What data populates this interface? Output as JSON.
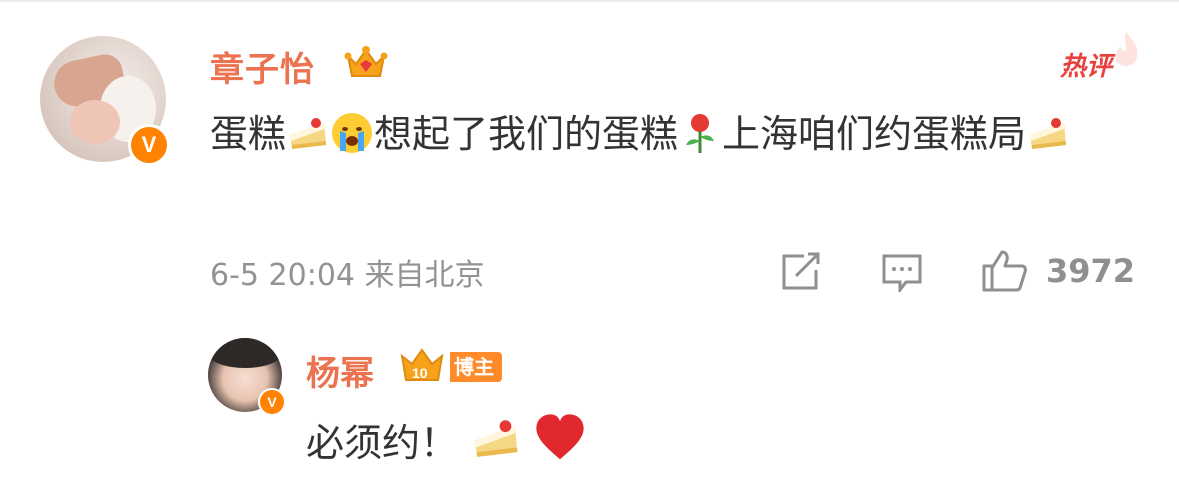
{
  "main_comment": {
    "author": "章子怡",
    "hot_label": "热评",
    "content_segments": [
      "蛋糕",
      "想起了我们的蛋糕",
      "上海咱们约蛋糕局"
    ],
    "timestamp": "6-5 20:04",
    "location": "来自北京",
    "like_count": "3972",
    "emojis": [
      "cake-emoji",
      "crying-emoji",
      "rose-emoji",
      "cake-emoji"
    ]
  },
  "reply": {
    "author": "杨幂",
    "badge_level": "10",
    "badge_label": "博主",
    "content": "必须约！",
    "emojis": [
      "cake-emoji",
      "heart-emoji"
    ]
  },
  "colors": {
    "name": "#eb7350",
    "hot": "#e8423f",
    "verified": "#ff8200",
    "meta": "#939393",
    "text": "#333333"
  }
}
